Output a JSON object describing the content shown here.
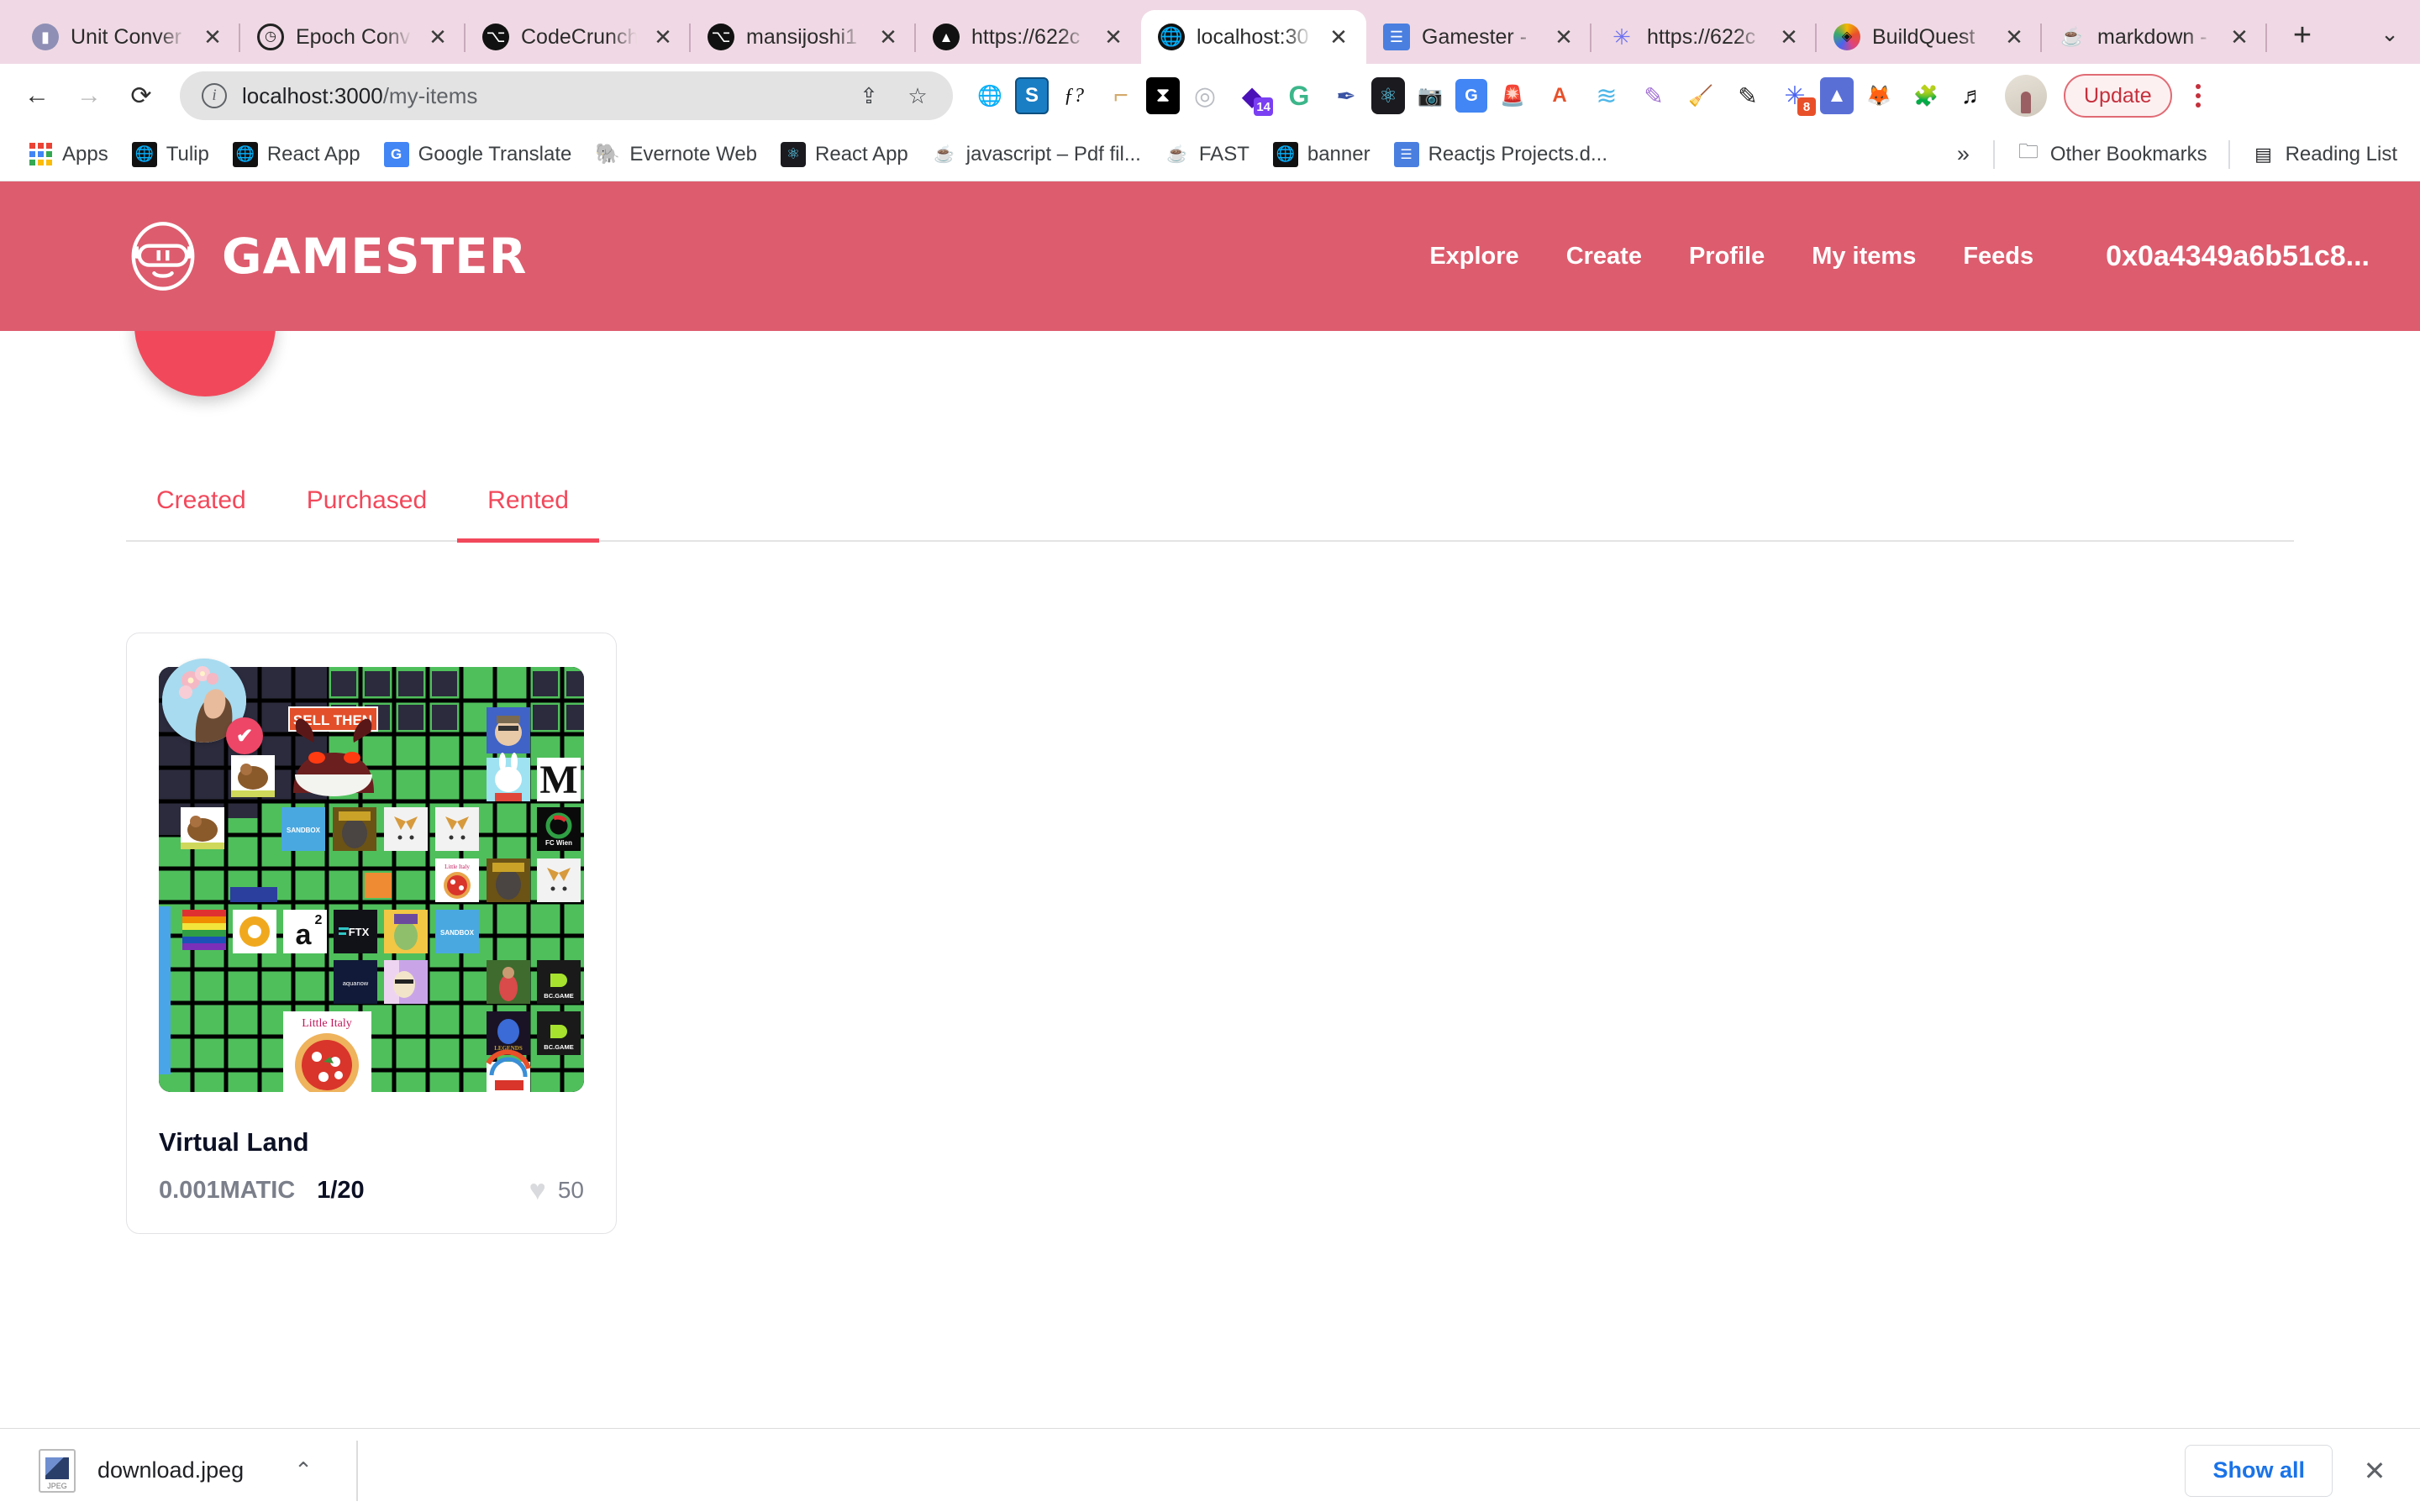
{
  "browser": {
    "tabs": [
      {
        "title": "Unit Conver",
        "icon": "chart-favicon",
        "active": false
      },
      {
        "title": "Epoch Conv",
        "icon": "clock-favicon",
        "active": false
      },
      {
        "title": "CodeCrunch",
        "icon": "github-favicon",
        "active": false
      },
      {
        "title": "mansijoshi1",
        "icon": "github-favicon",
        "active": false
      },
      {
        "title": "https://622c",
        "icon": "vercel-favicon",
        "active": false
      },
      {
        "title": "localhost:30",
        "icon": "globe-favicon",
        "active": true
      },
      {
        "title": "Gamester -",
        "icon": "notion-favicon",
        "active": false
      },
      {
        "title": "https://622c",
        "icon": "gatsby-favicon",
        "active": false
      },
      {
        "title": "BuildQuest",
        "icon": "ethereum-favicon",
        "active": false
      },
      {
        "title": "markdown -",
        "icon": "java-favicon",
        "active": false
      }
    ],
    "new_tab_label": "+",
    "tab_list_chevron": "⌄",
    "nav": {
      "back": "←",
      "forward": "→",
      "reload": "⟳"
    },
    "omnibox": {
      "info_icon": "i",
      "url_host": "localhost:3000",
      "url_path": "/my-items",
      "share_icon": "share-icon",
      "bookmark_icon": "star-icon"
    },
    "extensions": [
      {
        "name": "globe-extension",
        "glyph": "🌐",
        "bg": "transparent",
        "fg": "#9aa0a6"
      },
      {
        "name": "scribd-extension",
        "glyph": "S",
        "bg": "#1a7ec4",
        "fg": "#ffffff"
      },
      {
        "name": "mathjax-extension",
        "glyph": "ƒ?",
        "bg": "transparent",
        "fg": "#111111"
      },
      {
        "name": "ruler-extension",
        "glyph": "⌐",
        "bg": "transparent",
        "fg": "#d4a96a"
      },
      {
        "name": "measure-extension",
        "glyph": "✂",
        "bg": "#000000",
        "fg": "#ffffff"
      },
      {
        "name": "atom-extension",
        "glyph": "◎",
        "bg": "transparent",
        "fg": "#b9bcc2"
      },
      {
        "name": "pocket-extension",
        "glyph": "◆",
        "bg": "transparent",
        "fg": "#4b11b8",
        "badge": "14",
        "badge_color": "#7a3ff2"
      },
      {
        "name": "grammarly-extension",
        "glyph": "G",
        "bg": "transparent",
        "fg": "#3cb68b"
      },
      {
        "name": "eyedropper-extension",
        "glyph": "✒",
        "bg": "transparent",
        "fg": "#3a53a4"
      },
      {
        "name": "react-devtools-extension",
        "glyph": "⚛",
        "bg": "#1a1a1f",
        "fg": "#61dafb"
      },
      {
        "name": "screenshot-extension",
        "glyph": "📷",
        "bg": "transparent",
        "fg": "#9aa0a6"
      },
      {
        "name": "google-translate-extension",
        "glyph": "G",
        "bg": "#4285f4",
        "fg": "#ffffff"
      },
      {
        "name": "lighthouse-extension",
        "glyph": "🚨",
        "bg": "transparent",
        "fg": "#e8502a"
      },
      {
        "name": "adobe-extension",
        "glyph": "A",
        "bg": "transparent",
        "fg": "#e8502a"
      },
      {
        "name": "wifi-extension",
        "glyph": "≋",
        "bg": "transparent",
        "fg": "#4fb7e8"
      },
      {
        "name": "feather-extension",
        "glyph": "✎",
        "bg": "transparent",
        "fg": "#a06fd1"
      },
      {
        "name": "broom-extension",
        "glyph": "🧹",
        "bg": "transparent",
        "fg": "#d6ab36"
      },
      {
        "name": "notes-extension",
        "glyph": "✐",
        "bg": "transparent",
        "fg": "#222222"
      },
      {
        "name": "gatsby-extension",
        "glyph": "✳",
        "bg": "transparent",
        "fg": "#4a63f0",
        "badge": "8",
        "badge_color": "#e8502a"
      },
      {
        "name": "vercel-extension",
        "glyph": "▲",
        "bg": "#5a6fd6",
        "fg": "#ffffff"
      },
      {
        "name": "metamask-extension",
        "glyph": "🦊",
        "bg": "transparent",
        "fg": "#e2761b"
      },
      {
        "name": "puzzle-extension",
        "glyph": "🧩",
        "bg": "transparent",
        "fg": "#111111"
      },
      {
        "name": "playlist-extension",
        "glyph": "♬",
        "bg": "transparent",
        "fg": "#111111"
      }
    ],
    "update_button": "Update",
    "bookmarks": [
      {
        "label": "Apps",
        "icon": "apps-grid-icon"
      },
      {
        "label": "Tulip",
        "icon": "globe-dark-icon"
      },
      {
        "label": "React App",
        "icon": "globe-dark-icon"
      },
      {
        "label": "Google Translate",
        "icon": "google-translate-icon"
      },
      {
        "label": "Evernote Web",
        "icon": "evernote-icon"
      },
      {
        "label": "React App",
        "icon": "react-icon"
      },
      {
        "label": "javascript – Pdf fil...",
        "icon": "java-icon"
      },
      {
        "label": "FAST",
        "icon": "java-icon"
      },
      {
        "label": "banner",
        "icon": "globe-dark-icon"
      },
      {
        "label": "Reactjs Projects.d...",
        "icon": "notion-icon"
      }
    ],
    "bookmarks_overflow": "»",
    "other_bookmarks": "Other Bookmarks",
    "reading_list": "Reading List"
  },
  "site": {
    "brand": "GAMESTER",
    "nav_links": [
      "Explore",
      "Create",
      "Profile",
      "My items",
      "Feeds"
    ],
    "wallet_address": "0x0a4349a6b51c8...",
    "header_color": "#dd5c6e",
    "accent_color": "#f2485b"
  },
  "content": {
    "tabs": [
      {
        "label": "Created",
        "active": false
      },
      {
        "label": "Purchased",
        "active": false
      },
      {
        "label": "Rented",
        "active": true
      }
    ],
    "cards": [
      {
        "title": "Virtual Land",
        "price": "0.001MATIC",
        "supply": "1/20",
        "likes": "50",
        "heart_icon": "♥",
        "verified_icon": "✔",
        "avatar_name": "creator-avatar"
      }
    ]
  },
  "download_shelf": {
    "file_name": "download.jpeg",
    "file_type_label": "JPEG",
    "chevron": "⌃",
    "show_all_label": "Show all",
    "close_label": "✕"
  }
}
